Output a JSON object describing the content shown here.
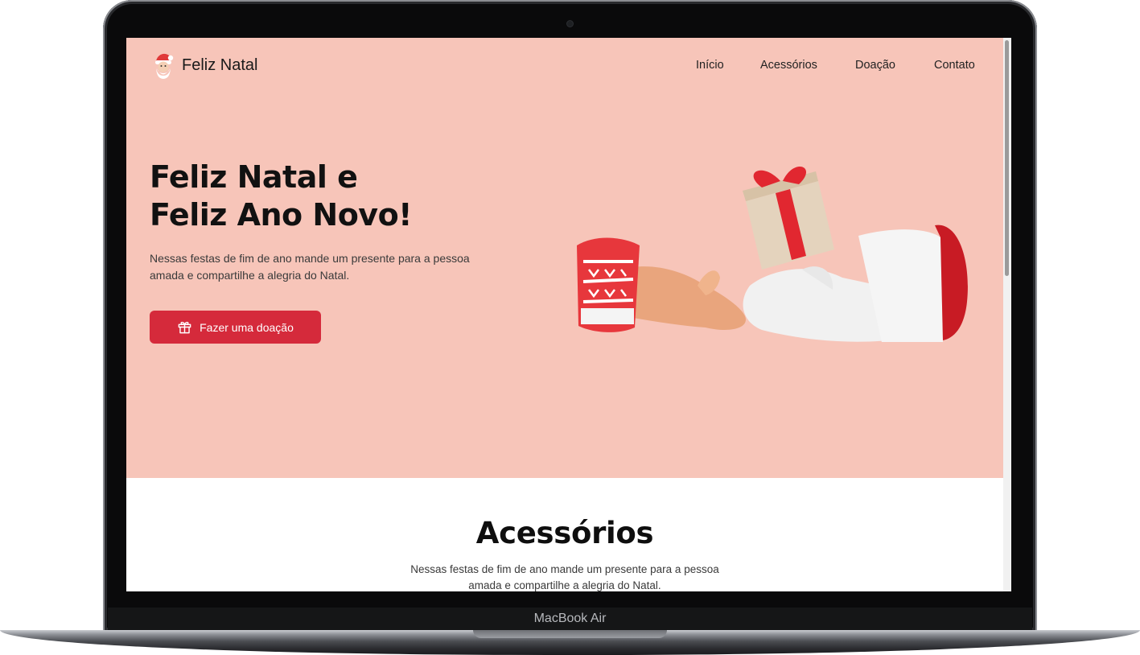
{
  "device": {
    "label": "MacBook Air"
  },
  "header": {
    "brand_name": "Feliz Natal",
    "brand_icon": "santa-icon",
    "nav": [
      {
        "label": "Início"
      },
      {
        "label": "Acessórios"
      },
      {
        "label": "Doação"
      },
      {
        "label": "Contato"
      }
    ]
  },
  "hero": {
    "title_line1": "Feliz Natal e",
    "title_line2": "Feliz Ano Novo!",
    "description": "Nessas festas de fim de ano mande um presente para a pessoa amada e compartilhe a alegria do Natal.",
    "cta_label": "Fazer uma doação",
    "cta_icon": "gift-icon"
  },
  "accessories": {
    "title": "Acessórios",
    "description": "Nessas festas de fim de ano mande um presente para a pessoa amada e compartilhe a alegria do Natal."
  },
  "colors": {
    "hero_background": "#f7c5b9",
    "accent": "#d52a3b",
    "text": "#111111"
  }
}
